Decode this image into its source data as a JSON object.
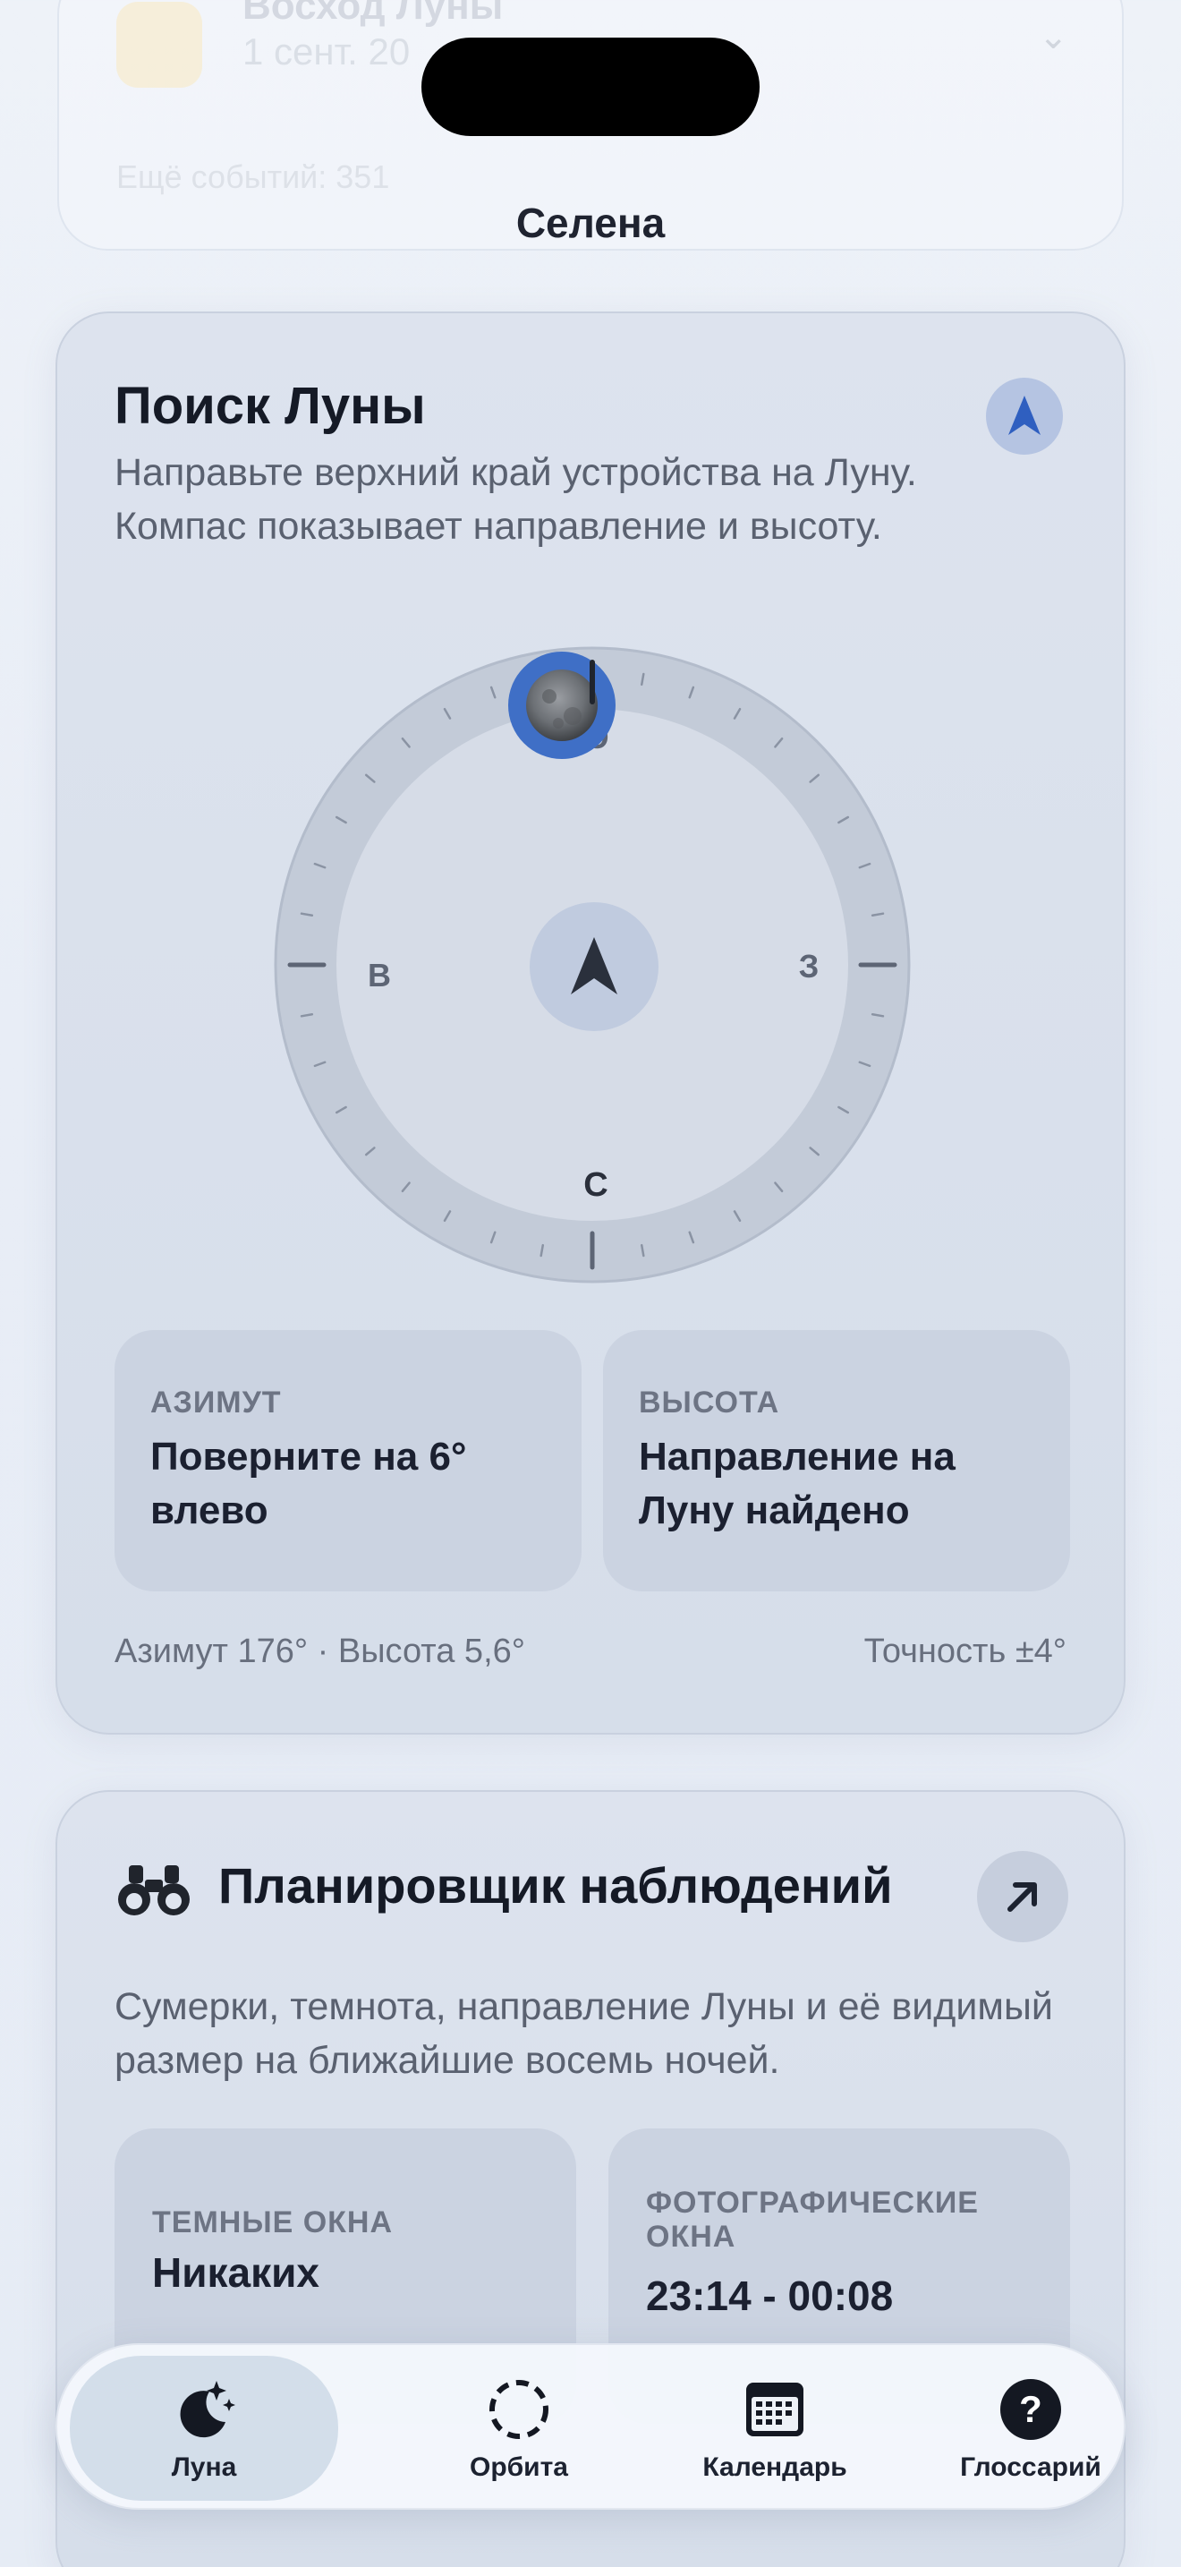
{
  "background_event": {
    "title": "Восход Луны",
    "date": "1 сент. 20",
    "more_events": "Ещё событий: 351"
  },
  "app": {
    "title": "Селена"
  },
  "moon_finder": {
    "title": "Поиск Луны",
    "description": "Направьте верхний край устройства на Луну. Компас показывает направление и высоту.",
    "compass": {
      "labels": {
        "north": "С",
        "south": "Ю",
        "east": "В",
        "west": "З"
      }
    },
    "azimuth_tile": {
      "label": "АЗИМУТ",
      "value": "Поверните на 6° влево"
    },
    "altitude_tile": {
      "label": "ВЫСОТА",
      "value": "Направление на Луну найдено"
    },
    "readout": "Азимут 176° · Высота 5,6°",
    "accuracy": "Точность ±4°",
    "accent_color": "#3f6fc6"
  },
  "planner": {
    "title": "Планировщик наблюдений",
    "description": "Сумерки, темнота, направление Луны и её видимый размер на ближайшие восемь ночей.",
    "dark_windows": {
      "label": "ТЕМНЫЕ ОКНА",
      "value": "Никаких"
    },
    "photo_windows": {
      "label": "ФОТОГРАФИЧЕСКИЕ ОКНА",
      "value": "23:14 - 00:08"
    }
  },
  "tabs": [
    {
      "label": "Луна",
      "icon": "moon-stars-icon",
      "active": true
    },
    {
      "label": "Орбита",
      "icon": "dashed-circle-icon",
      "active": false
    },
    {
      "label": "Календарь",
      "icon": "calendar-icon",
      "active": false
    },
    {
      "label": "Глоссарий",
      "icon": "question-icon",
      "active": false
    }
  ]
}
